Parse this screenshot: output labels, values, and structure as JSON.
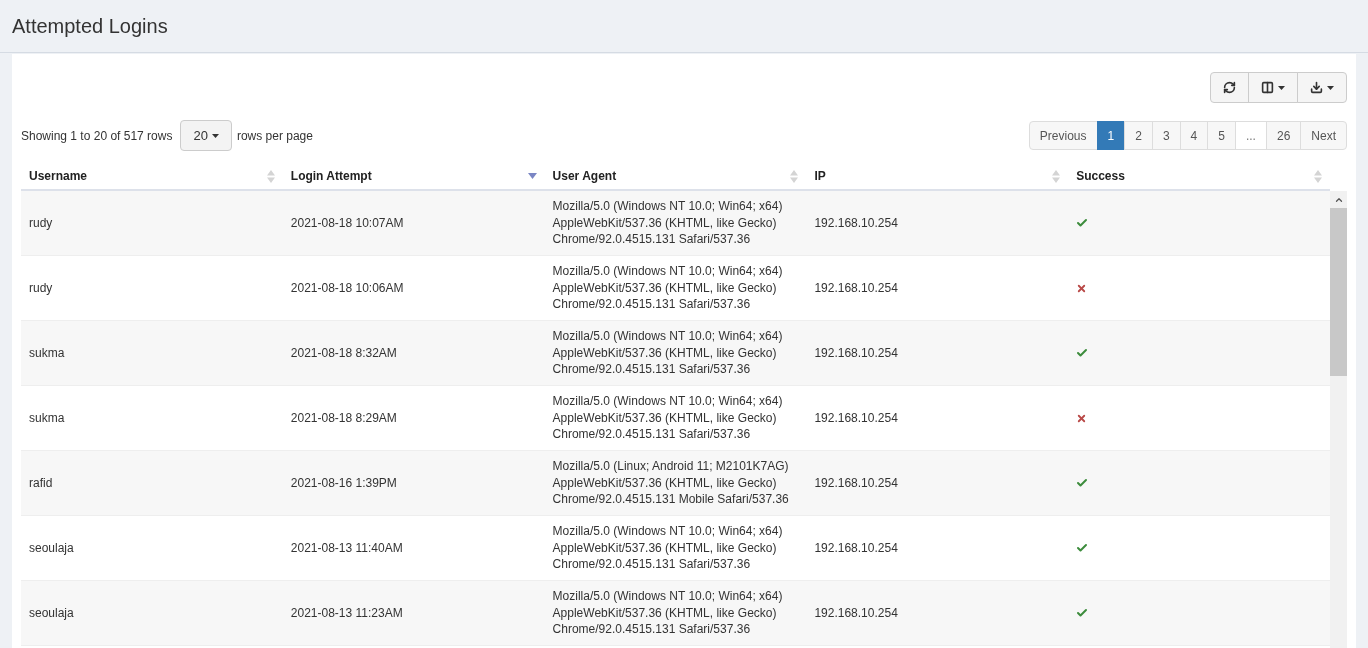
{
  "page": {
    "title": "Attempted Logins"
  },
  "toolbar": {
    "buttons": [
      {
        "kind": "refresh",
        "caret": false
      },
      {
        "kind": "columns",
        "caret": true
      },
      {
        "kind": "export",
        "caret": true
      }
    ]
  },
  "pagination_info": {
    "summary": "Showing 1 to 20 of 517 rows",
    "page_size": "20",
    "suffix": "rows per page"
  },
  "pagination": [
    {
      "label": "Previous",
      "selected": false,
      "disabled": false
    },
    {
      "label": "1",
      "selected": true,
      "disabled": false
    },
    {
      "label": "2",
      "selected": false,
      "disabled": false
    },
    {
      "label": "3",
      "selected": false,
      "disabled": false
    },
    {
      "label": "4",
      "selected": false,
      "disabled": false
    },
    {
      "label": "5",
      "selected": false,
      "disabled": false
    },
    {
      "label": "...",
      "selected": false,
      "disabled": true
    },
    {
      "label": "26",
      "selected": false,
      "disabled": false
    },
    {
      "label": "Next",
      "selected": false,
      "disabled": false
    }
  ],
  "table": {
    "columns": [
      {
        "label": "Username",
        "sorted": false
      },
      {
        "label": "Login Attempt",
        "sorted": true
      },
      {
        "label": "User Agent",
        "sorted": false
      },
      {
        "label": "IP",
        "sorted": false
      },
      {
        "label": "Success",
        "sorted": false
      }
    ],
    "rows": [
      {
        "username": "rudy",
        "time": "2021-08-18 10:07AM",
        "agent": [
          "Mozilla/5.0 (Windows NT 10.0; Win64; x64)",
          "AppleWebKit/537.36 (KHTML, like Gecko)",
          "Chrome/92.0.4515.131 Safari/537.36"
        ],
        "ip": "192.168.10.254",
        "success": true
      },
      {
        "username": "rudy",
        "time": "2021-08-18 10:06AM",
        "agent": [
          "Mozilla/5.0 (Windows NT 10.0; Win64; x64)",
          "AppleWebKit/537.36 (KHTML, like Gecko)",
          "Chrome/92.0.4515.131 Safari/537.36"
        ],
        "ip": "192.168.10.254",
        "success": false
      },
      {
        "username": "sukma",
        "time": "2021-08-18 8:32AM",
        "agent": [
          "Mozilla/5.0 (Windows NT 10.0; Win64; x64)",
          "AppleWebKit/537.36 (KHTML, like Gecko)",
          "Chrome/92.0.4515.131 Safari/537.36"
        ],
        "ip": "192.168.10.254",
        "success": true
      },
      {
        "username": "sukma",
        "time": "2021-08-18 8:29AM",
        "agent": [
          "Mozilla/5.0 (Windows NT 10.0; Win64; x64)",
          "AppleWebKit/537.36 (KHTML, like Gecko)",
          "Chrome/92.0.4515.131 Safari/537.36"
        ],
        "ip": "192.168.10.254",
        "success": false
      },
      {
        "username": "rafid",
        "time": "2021-08-16 1:39PM",
        "agent": [
          "Mozilla/5.0 (Linux; Android 11; M2101K7AG)",
          "AppleWebKit/537.36 (KHTML, like Gecko)",
          "Chrome/92.0.4515.131 Mobile Safari/537.36"
        ],
        "ip": "192.168.10.254",
        "success": true
      },
      {
        "username": "seoulaja",
        "time": "2021-08-13 11:40AM",
        "agent": [
          "Mozilla/5.0 (Windows NT 10.0; Win64; x64)",
          "AppleWebKit/537.36 (KHTML, like Gecko)",
          "Chrome/92.0.4515.131 Safari/537.36"
        ],
        "ip": "192.168.10.254",
        "success": true
      },
      {
        "username": "seoulaja",
        "time": "2021-08-13 11:23AM",
        "agent": [
          "Mozilla/5.0 (Windows NT 10.0; Win64; x64)",
          "AppleWebKit/537.36 (KHTML, like Gecko)",
          "Chrome/92.0.4515.131 Safari/537.36"
        ],
        "ip": "192.168.10.254",
        "success": true
      }
    ]
  }
}
